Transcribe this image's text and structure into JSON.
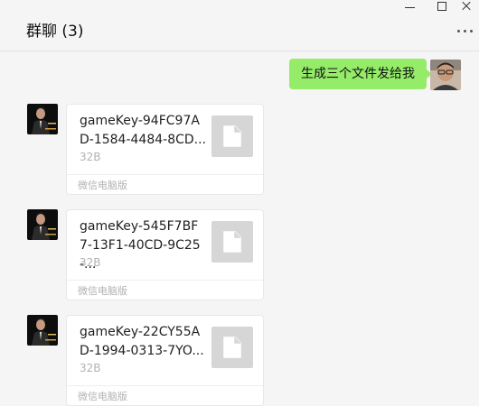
{
  "window": {
    "title": "群聊 (3)"
  },
  "icons": {
    "minimize": "minimize-icon",
    "maximize": "maximize-icon",
    "close": "close-icon",
    "more": "more-dots-icon",
    "file": "document-icon"
  },
  "colors": {
    "bubble_green": "#95ec69",
    "background": "#f5f5f5",
    "file_icon_bg": "#d6d6d6"
  },
  "messages": [
    {
      "type": "text",
      "direction": "outgoing",
      "text": "生成三个文件发给我"
    },
    {
      "type": "file",
      "direction": "incoming",
      "file_name": "gameKey-94FC97AD-1584-4484-8CD...",
      "size": "32B",
      "source": "微信电脑版"
    },
    {
      "type": "file",
      "direction": "incoming",
      "file_name": "gameKey-545F7BF7-13F1-40CD-9C25-...",
      "size": "32B",
      "source": "微信电脑版"
    },
    {
      "type": "file",
      "direction": "incoming",
      "file_name": "gameKey-22CY55AD-1994-0313-7YO...",
      "size": "32B",
      "source": "微信电脑版"
    }
  ]
}
